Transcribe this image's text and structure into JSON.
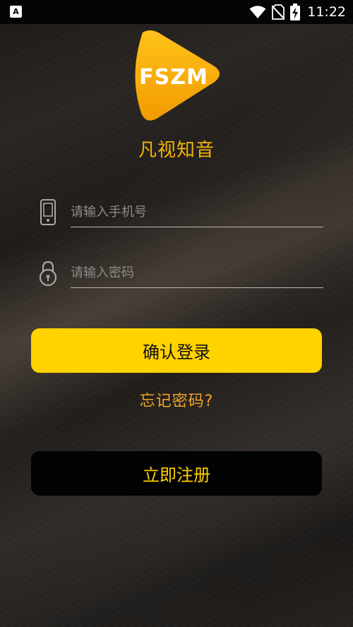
{
  "status_bar": {
    "notification_icon": "a-icon",
    "notification_glyph": "A",
    "time": "11:22",
    "icons": [
      "wifi-icon",
      "no-sim-icon",
      "battery-charging-icon"
    ]
  },
  "app": {
    "logo_text": "FSZM",
    "name": "凡视知音"
  },
  "login_form": {
    "phone_placeholder": "请输入手机号",
    "phone_value": "",
    "password_placeholder": "请输入密码",
    "password_value": "",
    "login_label": "确认登录",
    "forgot_label": "忘记密码?",
    "register_label": "立即注册"
  },
  "colors": {
    "accent_yellow": "#ffd200",
    "app_name": "#f5b400",
    "forgot_link": "#f1a524",
    "register_bg": "#030303"
  }
}
